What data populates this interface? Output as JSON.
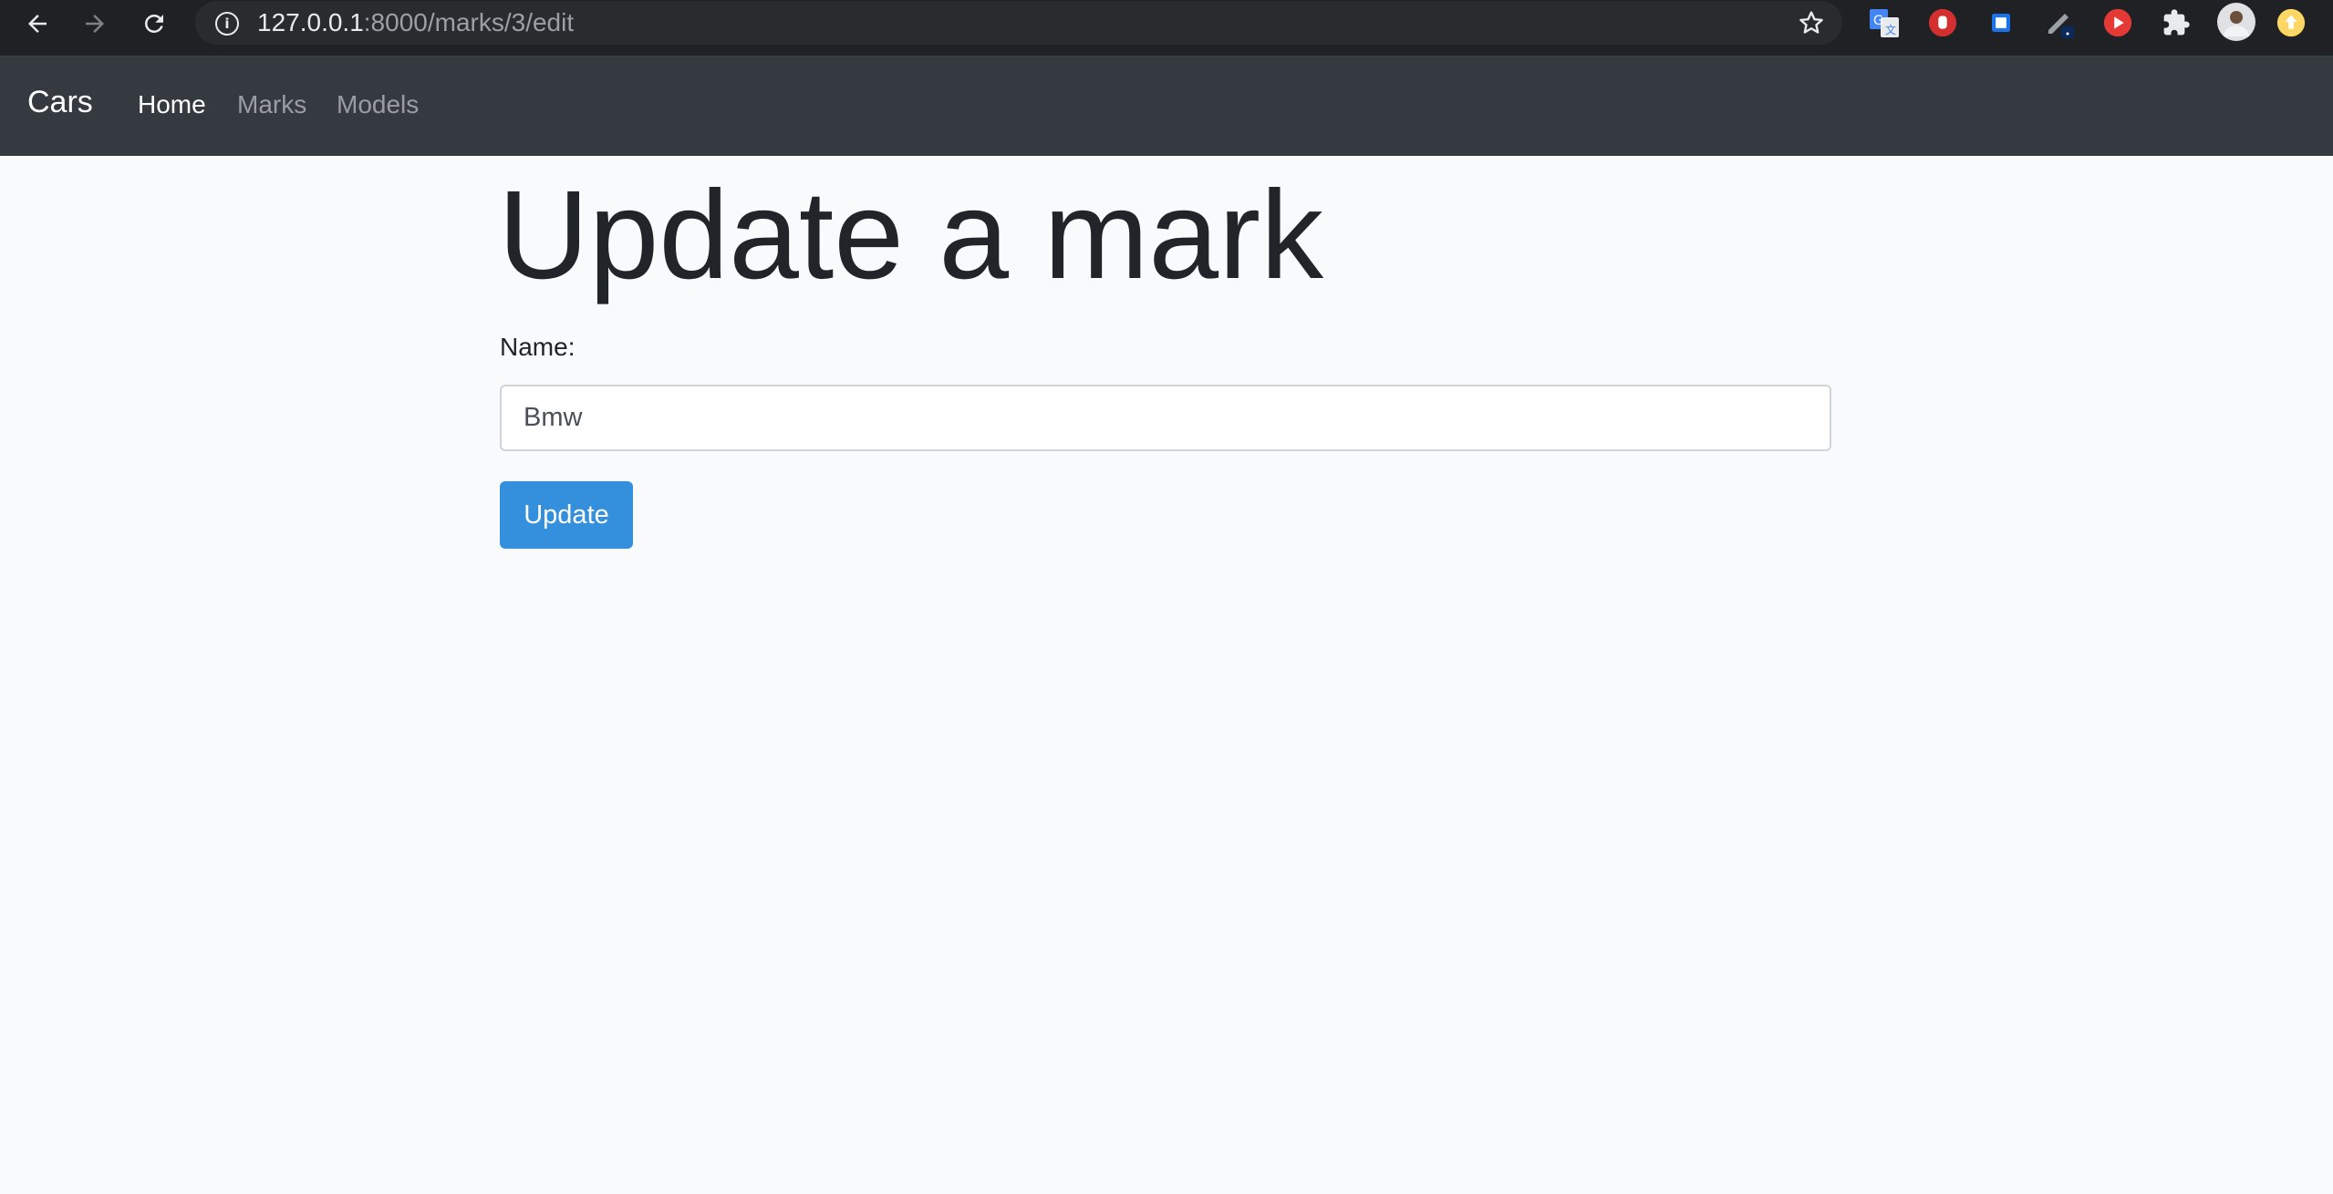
{
  "browser": {
    "url_host": "127.0.0.1",
    "url_path": ":8000/marks/3/edit",
    "icons": [
      "back-arrow-icon",
      "forward-arrow-icon",
      "reload-icon",
      "site-info-icon",
      "bookmark-star-icon",
      "translate-extension-icon",
      "adblock-extension-icon",
      "square-extension-icon",
      "pen-extension-icon",
      "youtube-extension-icon",
      "extensions-puzzle-icon",
      "profile-avatar",
      "update-indicator-icon"
    ]
  },
  "navbar": {
    "brand": "Cars",
    "links": [
      {
        "label": "Home",
        "active": true
      },
      {
        "label": "Marks",
        "active": false
      },
      {
        "label": "Models",
        "active": false
      }
    ]
  },
  "main": {
    "title": "Update a mark",
    "name_label": "Name:",
    "name_value": "Bmw",
    "submit_label": "Update"
  },
  "colors": {
    "navbar_bg": "#343a40",
    "page_bg": "#f8fafc",
    "button_bg": "#3490dc",
    "title_text": "#212529"
  }
}
